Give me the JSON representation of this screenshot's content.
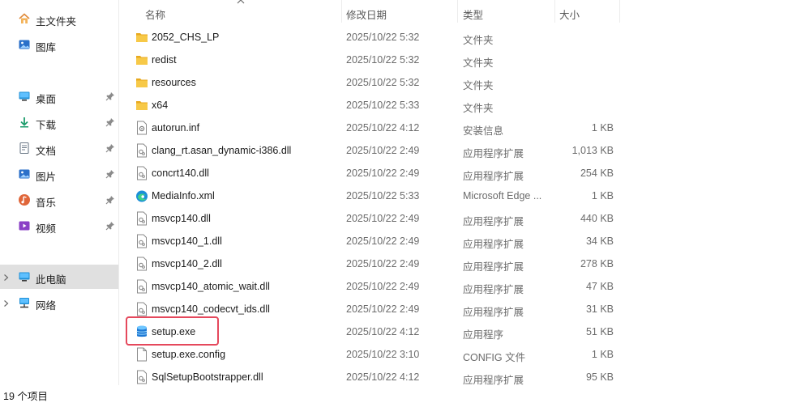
{
  "sidebar": {
    "quick": [
      {
        "label": "主文件夹",
        "icon": "home-icon"
      },
      {
        "label": "图库",
        "icon": "gallery-icon"
      }
    ],
    "pinned": [
      {
        "label": "桌面",
        "icon": "desktop-icon"
      },
      {
        "label": "下载",
        "icon": "download-icon"
      },
      {
        "label": "文档",
        "icon": "documents-icon"
      },
      {
        "label": "图片",
        "icon": "pictures-icon"
      },
      {
        "label": "音乐",
        "icon": "music-icon"
      },
      {
        "label": "视频",
        "icon": "videos-icon"
      }
    ],
    "tree": [
      {
        "label": "此电脑",
        "icon": "this-pc-icon",
        "selected": true
      },
      {
        "label": "网络",
        "icon": "network-icon",
        "selected": false
      }
    ]
  },
  "columns": {
    "name": "名称",
    "date": "修改日期",
    "type": "类型",
    "size": "大小"
  },
  "files": [
    {
      "name": "2052_CHS_LP",
      "date": "2025/10/22 5:32",
      "type": "文件夹",
      "size": "",
      "icon": "folder-icon"
    },
    {
      "name": "redist",
      "date": "2025/10/22 5:32",
      "type": "文件夹",
      "size": "",
      "icon": "folder-icon"
    },
    {
      "name": "resources",
      "date": "2025/10/22 5:32",
      "type": "文件夹",
      "size": "",
      "icon": "folder-icon"
    },
    {
      "name": "x64",
      "date": "2025/10/22 5:33",
      "type": "文件夹",
      "size": "",
      "icon": "folder-icon"
    },
    {
      "name": "autorun.inf",
      "date": "2025/10/22 4:12",
      "type": "安装信息",
      "size": "1 KB",
      "icon": "setup-info-file-icon"
    },
    {
      "name": "clang_rt.asan_dynamic-i386.dll",
      "date": "2025/10/22 2:49",
      "type": "应用程序扩展",
      "size": "1,013 KB",
      "icon": "dll-file-icon"
    },
    {
      "name": "concrt140.dll",
      "date": "2025/10/22 2:49",
      "type": "应用程序扩展",
      "size": "254 KB",
      "icon": "dll-file-icon"
    },
    {
      "name": "MediaInfo.xml",
      "date": "2025/10/22 5:33",
      "type": "Microsoft Edge ...",
      "size": "1 KB",
      "icon": "edge-icon"
    },
    {
      "name": "msvcp140.dll",
      "date": "2025/10/22 2:49",
      "type": "应用程序扩展",
      "size": "440 KB",
      "icon": "dll-file-icon"
    },
    {
      "name": "msvcp140_1.dll",
      "date": "2025/10/22 2:49",
      "type": "应用程序扩展",
      "size": "34 KB",
      "icon": "dll-file-icon"
    },
    {
      "name": "msvcp140_2.dll",
      "date": "2025/10/22 2:49",
      "type": "应用程序扩展",
      "size": "278 KB",
      "icon": "dll-file-icon"
    },
    {
      "name": "msvcp140_atomic_wait.dll",
      "date": "2025/10/22 2:49",
      "type": "应用程序扩展",
      "size": "47 KB",
      "icon": "dll-file-icon"
    },
    {
      "name": "msvcp140_codecvt_ids.dll",
      "date": "2025/10/22 2:49",
      "type": "应用程序扩展",
      "size": "31 KB",
      "icon": "dll-file-icon"
    },
    {
      "name": "setup.exe",
      "date": "2025/10/22 4:12",
      "type": "应用程序",
      "size": "51 KB",
      "icon": "setup-exe-icon"
    },
    {
      "name": "setup.exe.config",
      "date": "2025/10/22 3:10",
      "type": "CONFIG 文件",
      "size": "1 KB",
      "icon": "config-file-icon"
    },
    {
      "name": "SqlSetupBootstrapper.dll",
      "date": "2025/10/22 4:12",
      "type": "应用程序扩展",
      "size": "95 KB",
      "icon": "dll-file-icon"
    }
  ],
  "status": {
    "item_count": "19 个项目"
  },
  "colors": {
    "highlight": "#e5485c",
    "folder": "#f4c542",
    "selected_bg": "#e0e0e0"
  }
}
